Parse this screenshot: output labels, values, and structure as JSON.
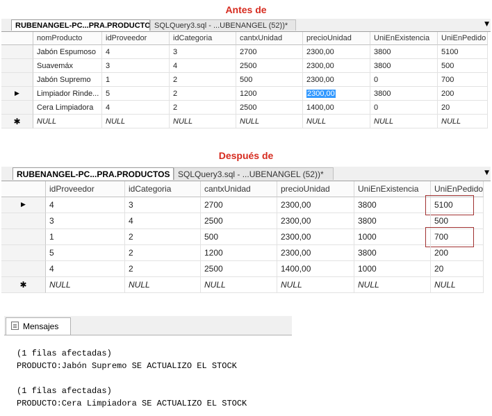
{
  "headings": {
    "before": "Antes de",
    "after": "Después de"
  },
  "before_panel": {
    "tabs": [
      {
        "label": "RUBENANGEL-PC...PRA.PRODUCTOS",
        "active": true
      },
      {
        "label": "SQLQuery3.sql - ...UBENANGEL (52))*",
        "active": false
      }
    ],
    "columns": [
      "nomProducto",
      "idProveedor",
      "idCategoria",
      "cantxUnidad",
      "precioUnidad",
      "UniEnExistencia",
      "UniEnPedido"
    ],
    "rows": [
      {
        "indicator": "",
        "cells": [
          "Jabón Espumoso",
          "4",
          "3",
          "2700",
          "2300,00",
          "3800",
          "5100"
        ]
      },
      {
        "indicator": "",
        "cells": [
          "Suavemáx",
          "3",
          "4",
          "2500",
          "2300,00",
          "3800",
          "500"
        ]
      },
      {
        "indicator": "",
        "cells": [
          "Jabón Supremo",
          "1",
          "2",
          "500",
          "2300,00",
          "0",
          "700"
        ]
      },
      {
        "indicator": "▶",
        "cells": [
          "Limpiador Rinde...",
          "5",
          "2",
          "1200",
          "2300,00",
          "3800",
          "200"
        ]
      },
      {
        "indicator": "",
        "cells": [
          "Cera Limpiadora",
          "4",
          "2",
          "2500",
          "1400,00",
          "0",
          "20"
        ]
      },
      {
        "indicator": "✱",
        "cells": [
          "NULL",
          "NULL",
          "NULL",
          "NULL",
          "NULL",
          "NULL",
          "NULL"
        ]
      }
    ]
  },
  "after_panel": {
    "tabs": [
      {
        "label": "RUBENANGEL-PC...PRA.PRODUCTOS",
        "active": true
      },
      {
        "label": "SQLQuery3.sql - ...UBENANGEL (52))*",
        "active": false
      }
    ],
    "columns": [
      "idProveedor",
      "idCategoria",
      "cantxUnidad",
      "precioUnidad",
      "UniEnExistencia",
      "UniEnPedido"
    ],
    "rows": [
      {
        "indicator": "▶",
        "cells": [
          "4",
          "3",
          "2700",
          "2300,00",
          "3800",
          "5100"
        ]
      },
      {
        "indicator": "",
        "cells": [
          "3",
          "4",
          "2500",
          "2300,00",
          "3800",
          "500"
        ]
      },
      {
        "indicator": "",
        "cells": [
          "1",
          "2",
          "500",
          "2300,00",
          "1000",
          "700"
        ]
      },
      {
        "indicator": "",
        "cells": [
          "5",
          "2",
          "1200",
          "2300,00",
          "3800",
          "200"
        ]
      },
      {
        "indicator": "",
        "cells": [
          "4",
          "2",
          "2500",
          "1400,00",
          "1000",
          "20"
        ]
      },
      {
        "indicator": "✱",
        "cells": [
          "NULL",
          "NULL",
          "NULL",
          "NULL",
          "NULL",
          "NULL"
        ]
      }
    ]
  },
  "messages": {
    "tab_label": "Mensajes",
    "lines": [
      "(1 filas afectadas)",
      "PRODUCTO:Jabón Supremo SE ACTUALIZO EL STOCK",
      "",
      "(1 filas afectadas)",
      "PRODUCTO:Cera Limpiadora SE ACTUALIZO EL STOCK"
    ]
  },
  "icons": {
    "current_row": "row-pointer-icon",
    "new_row": "new-row-asterisk-icon",
    "dropdown": "chevron-down-icon",
    "messages": "messages-icon"
  },
  "colors": {
    "heading": "#d62b1f",
    "selection": "#3399ff",
    "highlight_box": "#a03030"
  }
}
